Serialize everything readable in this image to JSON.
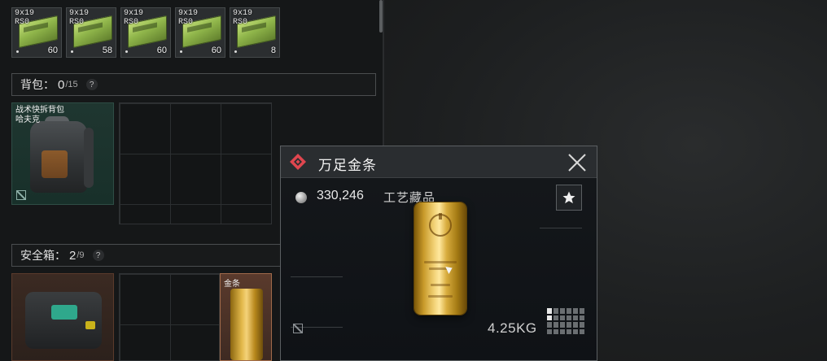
{
  "ammo_row": [
    {
      "caliber": "9x19",
      "type": "RS0",
      "count": "60"
    },
    {
      "caliber": "9x19",
      "type": "RS0",
      "count": "58"
    },
    {
      "caliber": "9x19",
      "type": "RS0",
      "count": "60"
    },
    {
      "caliber": "9x19",
      "type": "RS0",
      "count": "60"
    },
    {
      "caliber": "9x19",
      "type": "RS0",
      "count": "8"
    }
  ],
  "backpack_section": {
    "label": "背包：",
    "count": "0",
    "max": "/15",
    "help": "?"
  },
  "backpack_item": {
    "name": "战术快拆背包\n哈夫克"
  },
  "safebox_section": {
    "label": "安全箱：",
    "count": "2",
    "max": "/9",
    "help": "?"
  },
  "safebox_item": {
    "name": "金条"
  },
  "tooltip": {
    "title": "万足金条",
    "price": "330,246",
    "category": "工艺藏品",
    "weight": "4.25KG",
    "rarity_color": "#e0464f",
    "size_grid_filled": 2
  },
  "icons": {
    "rarity": "diamond-icon",
    "close": "close-icon",
    "favorite": "star-icon",
    "currency": "coin-icon",
    "no_insure": "no-insure-icon"
  }
}
